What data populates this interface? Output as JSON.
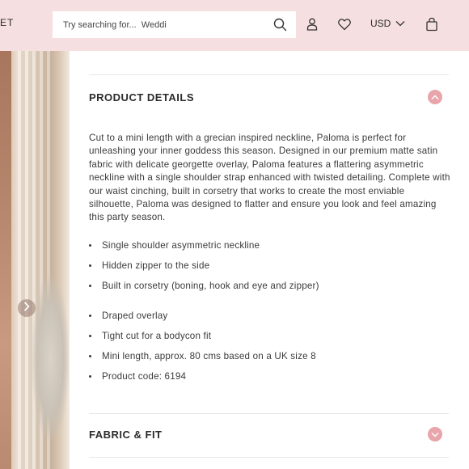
{
  "header": {
    "logo_fragment": "ET",
    "search": {
      "placeholder": "Try searching for...  Weddi"
    },
    "currency": "USD",
    "icons": {
      "search": "search-icon",
      "account": "user-icon",
      "wishlist": "heart-icon",
      "currency_toggle": "chevron-down-icon",
      "cart": "bag-icon"
    }
  },
  "gallery": {
    "next_icon": "chevron-right-icon"
  },
  "product_details": {
    "title": "PRODUCT DETAILS",
    "toggle_icon": "chevron-up-icon",
    "description": "Cut to a mini length with a grecian inspired neckline, Paloma is perfect for unleashing your inner goddess this season. Designed in our premium matte satin fabric with delicate georgette overlay, Paloma features a flattering asymmetric neckline with a single shoulder strap enhanced with twisted detailing. Complete with our waist cinching, built in corsetry that works to create the most enviable silhouette, Paloma was designed to flatter and ensure you look and feel amazing this party season.",
    "features_a": [
      "Single shoulder asymmetric neckline",
      "Hidden zipper to the side",
      "Built in corsetry (boning, hook and eye and zipper)"
    ],
    "features_b": [
      "Draped overlay",
      "Tight cut for a bodycon fit",
      "Mini length, approx. 80 cms based on a UK size 8",
      "Product code: 6194"
    ]
  },
  "fabric_fit": {
    "title": "FABRIC & FIT",
    "toggle_icon": "chevron-down-icon"
  },
  "colors": {
    "header_bg": "#f6dfe0",
    "accent": "#e8a5ab",
    "text": "#2b2b2b"
  }
}
